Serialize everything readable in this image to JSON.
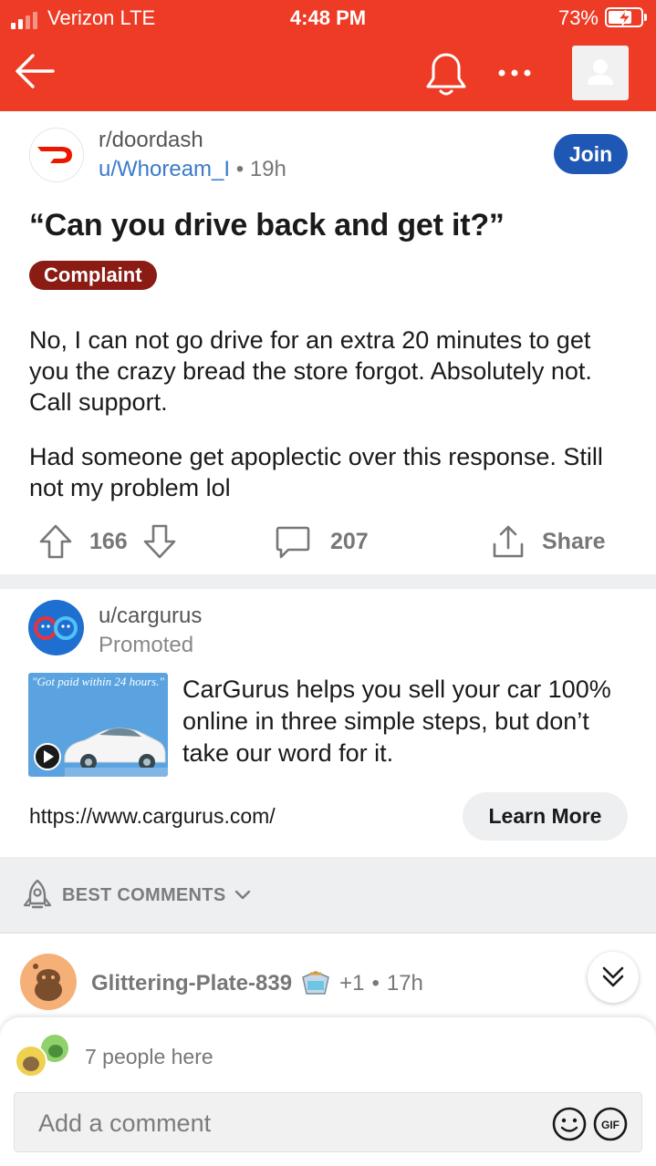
{
  "status_bar": {
    "carrier": "Verizon  LTE",
    "time": "4:48 PM",
    "battery_percent": "73%",
    "battery_level": 0.73,
    "charging": true
  },
  "header": {
    "back_icon": "arrow-left-icon",
    "bell_icon": "bell-icon",
    "more_icon": "more-horizontal-icon",
    "avatar_icon": "user-avatar-icon",
    "color": "#ee3b25"
  },
  "post": {
    "subreddit": "r/doordash",
    "author": "u/Whoream_I",
    "age": "19h",
    "join_label": "Join",
    "title": "“Can you drive back and get it?”",
    "flair": "Complaint",
    "flair_color": "#8a1c13",
    "body": [
      "No, I can not go drive for an extra 20 minutes to get you the crazy bread the store forgot. Absolutely not. Call support.",
      "Had someone get apoplectic over this response. Still not my problem lol"
    ],
    "upvotes": "166",
    "comments": "207",
    "share_label": "Share"
  },
  "promoted": {
    "user": "u/cargurus",
    "label": "Promoted",
    "thumbnail_caption": "\"Got paid within 24 hours.\"",
    "text": "CarGurus helps you sell your car 100% online in three simple steps, but don’t take our word for it.",
    "url": "https://www.cargurus.com/",
    "cta_label": "Learn More"
  },
  "comments_sort": {
    "label": "BEST COMMENTS",
    "icon": "rocket-icon"
  },
  "comment": {
    "user": "Glittering-Plate-839",
    "award_icon": "award-icon",
    "score": "+1",
    "age": "17h"
  },
  "bottom_sheet": {
    "people_here": "7 people here",
    "input_placeholder": "Add a comment",
    "emoji_icon": "emoji-icon",
    "gif_icon": "gif-icon"
  }
}
